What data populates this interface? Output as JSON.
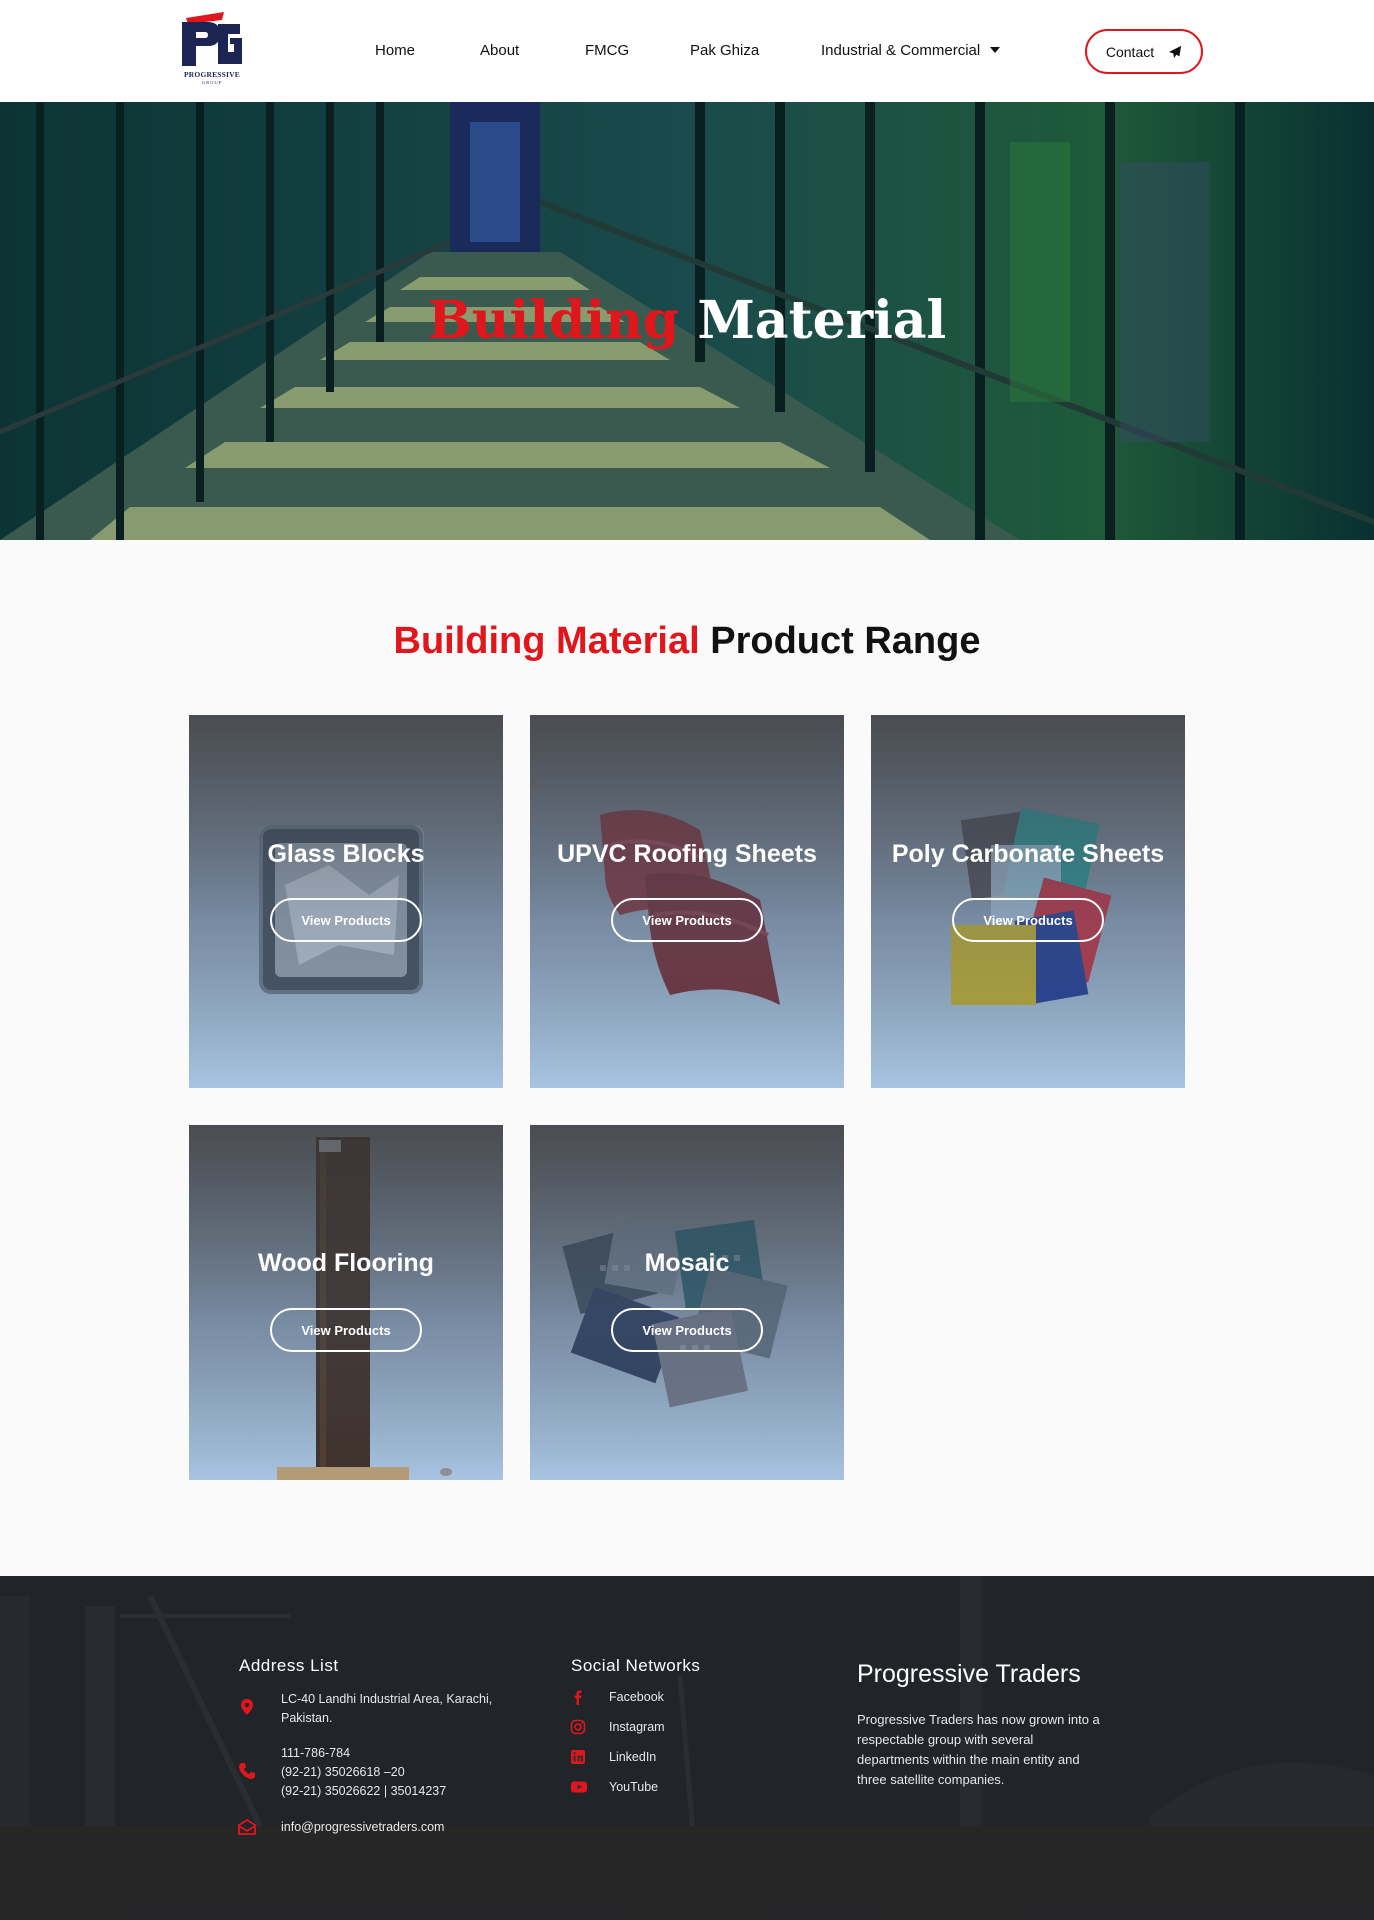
{
  "header": {
    "logo_text": "PROGRESSIVE",
    "logo_sub": "GROUP",
    "nav": [
      {
        "label": "Home"
      },
      {
        "label": "About"
      },
      {
        "label": "FMCG"
      },
      {
        "label": "Pak Ghiza"
      },
      {
        "label": "Industrial & Commercial"
      }
    ],
    "contact_label": "Contact"
  },
  "hero": {
    "title_red": "Building",
    "title_white": "Material"
  },
  "section": {
    "title_red": "Building Material",
    "title_dark": "Product Range"
  },
  "cards": [
    {
      "title": "Glass Blocks",
      "button": "View Products"
    },
    {
      "title": "UPVC Roofing Sheets",
      "button": "View Products"
    },
    {
      "title": "Poly Carbonate Sheets",
      "button": "View Products"
    },
    {
      "title": "Wood Flooring",
      "button": "View Products"
    },
    {
      "title": "Mosaic",
      "button": "View Products"
    }
  ],
  "footer": {
    "address_heading": "Address List",
    "address_lines": [
      "LC-40 Landhi Industrial Area, Karachi,",
      "Pakistan."
    ],
    "phone_lines": [
      "111-786-784",
      "(92-21) 35026618 –20",
      "(92-21) 35026622 | 35014237"
    ],
    "email": "info@progressivetraders.com",
    "social_heading": "Social Networks",
    "social": [
      {
        "label": "Facebook",
        "icon": "facebook-icon"
      },
      {
        "label": "Instagram",
        "icon": "instagram-icon"
      },
      {
        "label": "LinkedIn",
        "icon": "linkedin-icon"
      },
      {
        "label": "YouTube",
        "icon": "youtube-icon"
      }
    ],
    "brand": "Progressive Traders",
    "about_lines": [
      "Progressive Traders has now grown into a",
      "respectable group with several",
      "departments within the main entity and",
      "three satellite companies."
    ]
  },
  "colors": {
    "accent": "#e0161d",
    "navy": "#1b2453",
    "footer_bg": "#24272c"
  }
}
